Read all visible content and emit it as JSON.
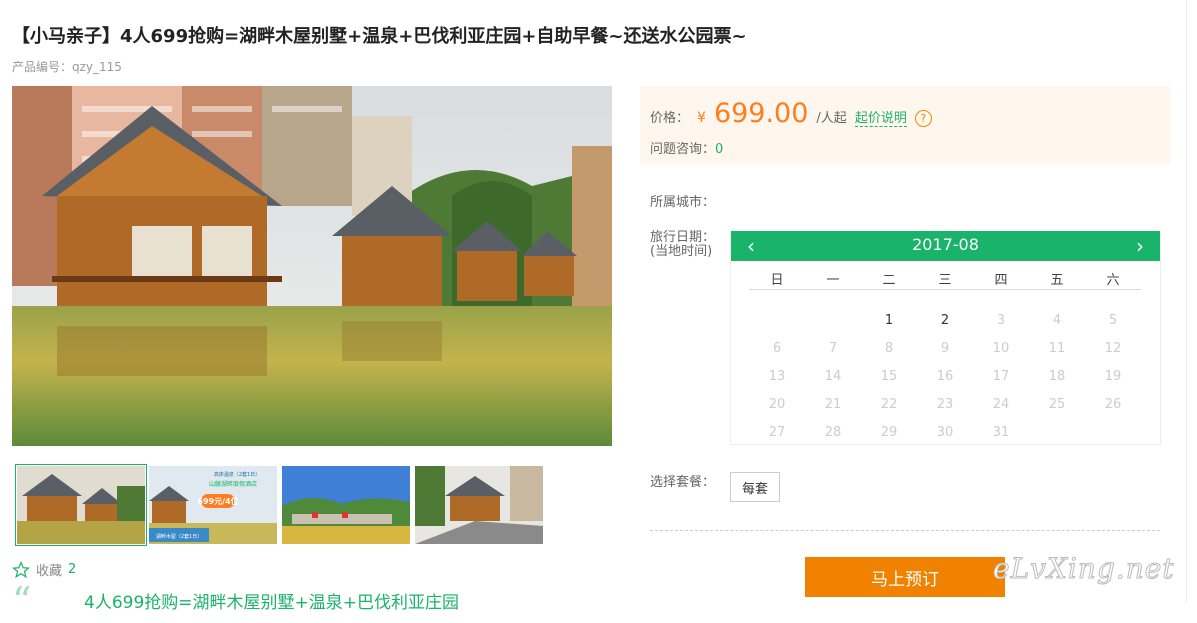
{
  "product": {
    "title": "【小马亲子】4人699抢购=湖畔木屋别墅+温泉+巴伐利亚庄园+自助早餐~还送水公园票~",
    "code": "产品编号：qzy_115"
  },
  "gallery": {
    "thumbnails": [
      {
        "name": "thumb-1",
        "selected": true
      },
      {
        "name": "thumb-2",
        "selected": false,
        "texts": [
          "高床温泉（2套1日）",
          "山腰湖畔度假酒店",
          "699元/4位",
          "湖畔木屋（2套1日）"
        ]
      },
      {
        "name": "thumb-3",
        "selected": false
      },
      {
        "name": "thumb-4",
        "selected": false
      }
    ]
  },
  "favorite": {
    "label": "收藏",
    "count": "2"
  },
  "description_preview": "4人699抢购=湖畔木屋别墅+温泉+巴伐利亚庄园",
  "price_box": {
    "price_label": "价格：",
    "currency": "¥",
    "price": "699.00",
    "unit": "/人起",
    "price_link": "起价说明",
    "help_icon": "?",
    "consult_label": "问题咨询：",
    "consult_count": "0"
  },
  "city_label": "所属城市：",
  "travel_date_label_1": "旅行日期：",
  "travel_date_label_2": "(当地时间)",
  "calendar": {
    "month": "2017-08",
    "prev": "‹",
    "next": "›",
    "weekdays": [
      "日",
      "一",
      "二",
      "三",
      "四",
      "五",
      "六"
    ],
    "days": [
      "1",
      "2",
      "3",
      "4",
      "5",
      "6",
      "7",
      "8",
      "9",
      "10",
      "11",
      "12",
      "13",
      "14",
      "15",
      "16",
      "17",
      "18",
      "19",
      "20",
      "21",
      "22",
      "23",
      "24",
      "25",
      "26",
      "27",
      "28",
      "29",
      "30",
      "31"
    ],
    "available_days": [
      "1",
      "2"
    ]
  },
  "package": {
    "label": "选择套餐：",
    "option": "每套"
  },
  "book_button": "马上预订",
  "watermark": "eLvXing.net",
  "colors": {
    "accent_green": "#19b36b",
    "price_orange": "#ff7d1e",
    "book_orange": "#f08200",
    "price_bg": "#fff7ee"
  }
}
